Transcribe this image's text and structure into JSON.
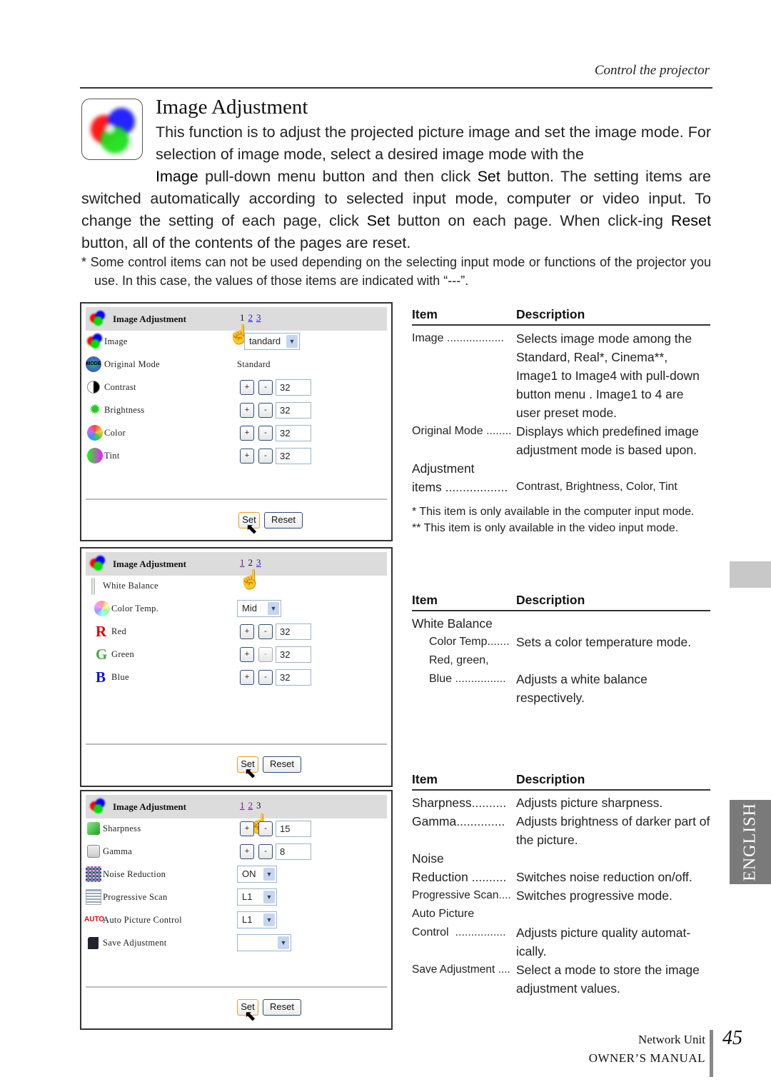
{
  "header": {
    "running_head": "Control the projector",
    "section_title": "Image Adjustment",
    "section_icon": "rgb-color-circles-icon"
  },
  "intro": {
    "line1": "This function is to adjust the projected picture image and set the image mode. For selection of image mode, select a desired image mode with the",
    "kw_image": "Image",
    "p2": " pull-down menu button and then click ",
    "kw_set": "Set",
    "p3": " button. The setting items are switched automatically according to selected input mode, computer or video input. To change the setting of each page, click ",
    "kw_set2": "Set",
    "p4": " button on each page. When click-ing ",
    "kw_reset": "Reset",
    "p5": " button, all of the contents of the pages are reset.",
    "note": "* Some control items can not be used depending on the selecting input mode or functions of the projector you use. In this case, the values of those items are indicated with “---”."
  },
  "panels": [
    {
      "title": "Image Adjustment",
      "pages": [
        "1",
        "2",
        "3"
      ],
      "current_page": "1",
      "rows": [
        {
          "label": "Image",
          "icon": "rgb-circles-icon",
          "control": "select",
          "value": "tandard"
        },
        {
          "label": "Original Mode",
          "icon": "mode-icon",
          "control": "text",
          "value": "Standard"
        },
        {
          "label": "Contrast",
          "icon": "contrast-icon",
          "control": "stepper",
          "value": "32"
        },
        {
          "label": "Brightness",
          "icon": "brightness-sun-icon",
          "control": "stepper",
          "value": "32"
        },
        {
          "label": "Color",
          "icon": "color-sphere-icon",
          "control": "stepper",
          "value": "32"
        },
        {
          "label": "Tint",
          "icon": "tint-icon",
          "control": "stepper",
          "value": "32"
        }
      ],
      "set_label": "Set",
      "reset_label": "Reset"
    },
    {
      "title": "Image Adjustment",
      "pages": [
        "1",
        "2",
        "3"
      ],
      "current_page": "2",
      "rows": [
        {
          "label": "White Balance",
          "icon": "white-balance-bar-icon",
          "control": "none",
          "value": ""
        },
        {
          "label": "Color Temp.",
          "icon": "color-wheel-icon",
          "control": "select",
          "value": "Mid"
        },
        {
          "label": "Red",
          "icon": "letter-r-icon",
          "control": "stepper",
          "value": "32"
        },
        {
          "label": "Green",
          "icon": "letter-g-icon",
          "control": "stepper",
          "value": "32"
        },
        {
          "label": "Blue",
          "icon": "letter-b-icon",
          "control": "stepper",
          "value": "32"
        }
      ],
      "set_label": "Set",
      "reset_label": "Reset"
    },
    {
      "title": "Image Adjustment",
      "pages": [
        "1",
        "2",
        "3"
      ],
      "current_page": "3",
      "rows": [
        {
          "label": "Sharpness",
          "icon": "green-cube-icon",
          "control": "stepper",
          "value": "15"
        },
        {
          "label": "Gamma",
          "icon": "gamma-curve-icon",
          "control": "stepper",
          "value": "8"
        },
        {
          "label": "Noise Reduction",
          "icon": "noise-icon",
          "control": "select",
          "value": "ON"
        },
        {
          "label": "Progressive Scan",
          "icon": "scan-lines-icon",
          "control": "select",
          "value": "L1"
        },
        {
          "label": "Auto Picture Control",
          "icon": "auto-icon",
          "control": "select",
          "value": "L1"
        },
        {
          "label": "Save Adjustment",
          "icon": "floppy-disk-icon",
          "control": "select",
          "value": ""
        }
      ],
      "set_label": "Set",
      "reset_label": "Reset"
    }
  ],
  "tables": [
    {
      "col_item": "Item",
      "col_desc": "Description",
      "entries": [
        {
          "item": "Image",
          "desc": "Selects image mode among the Standard, Real*, Cinema**, Image1 to Image4 with pull-down button menu . Image1 to 4 are user preset mode."
        },
        {
          "item": "Original Mode",
          "desc": "Displays which predefined image adjustment mode is based upon."
        },
        {
          "item_line1": "Adjustment",
          "item": "items",
          "desc": "Contrast, Brightness, Color, Tint"
        }
      ],
      "footnotes": [
        "* This item is only available in the computer input mode.",
        "** This item is only available in the video input mode."
      ]
    },
    {
      "col_item": "Item",
      "col_desc": "Description",
      "group": "White Balance",
      "entries": [
        {
          "item": "Color Temp.",
          "desc": "Sets a color temperature mode."
        },
        {
          "item_line1": "Red, green,",
          "item": "Blue",
          "desc": "Adjusts a white balance respectively."
        }
      ]
    },
    {
      "col_item": "Item",
      "col_desc": "Description",
      "entries": [
        {
          "item": "Sharpness",
          "desc": "Adjusts picture sharpness."
        },
        {
          "item": "Gamma",
          "desc": "Adjusts brightness of darker part of the picture."
        },
        {
          "item_line1": "Noise",
          "item": "Reduction",
          "desc": "Switches noise reduction on/off."
        },
        {
          "item": "Progressive Scan",
          "desc": "Switches progressive mode."
        },
        {
          "item_line1": "Auto Picture",
          "item": "Control",
          "desc": "Adjusts picture quality automat-ically."
        },
        {
          "item": "Save Adjustment",
          "desc": "Select a mode to store the image adjustment values."
        }
      ]
    }
  ],
  "side_tab": {
    "label": "ENGLISH"
  },
  "footer": {
    "unit": "Network Unit",
    "manual": "OWNER’S MANUAL",
    "page_number": "45"
  },
  "dots": {
    "image": "..................",
    "original_mode": "........",
    "items": "..................",
    "color_temp": "......",
    "blue": "................",
    "sharpness": "..........",
    "gamma": "..............",
    "reduction": "..........",
    "progressive": "....",
    "control": "................",
    "save": "...."
  }
}
